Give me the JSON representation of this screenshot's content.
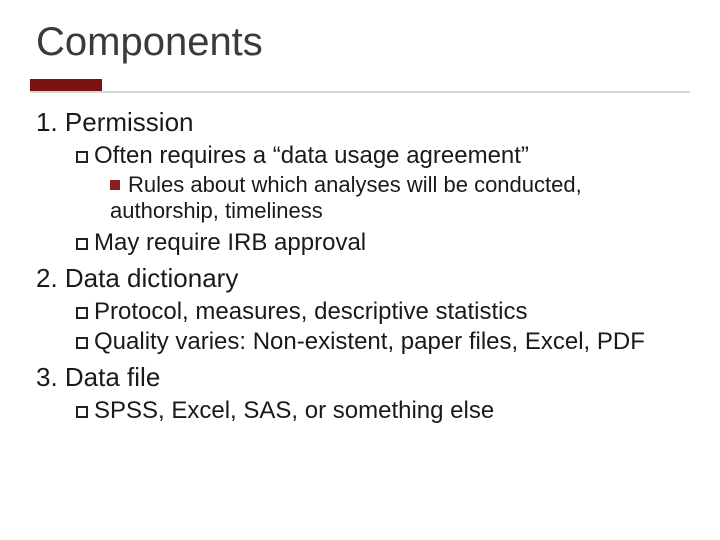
{
  "title": "Components",
  "items": [
    {
      "label": "1. Permission",
      "children": [
        {
          "label": "Often requires a “data usage agreement”",
          "children": [
            {
              "label": "Rules about which analyses will be conducted, authorship, timeliness"
            }
          ]
        },
        {
          "label": "May require IRB approval"
        }
      ]
    },
    {
      "label": "2. Data dictionary",
      "children": [
        {
          "label": "Protocol, measures, descriptive statistics"
        },
        {
          "label": "Quality varies: Non-existent, paper files, Excel, PDF"
        }
      ]
    },
    {
      "label": "3. Data file",
      "children": [
        {
          "label": "SPSS, Excel, SAS, or something else"
        }
      ]
    }
  ]
}
